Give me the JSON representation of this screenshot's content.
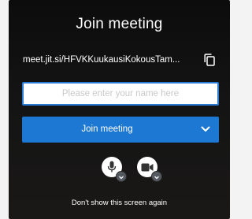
{
  "dialog": {
    "title": "Join meeting",
    "meeting_url": "meet.jit.si/HFVKKuukausiKokousTam...",
    "name_input": {
      "placeholder": "Please enter your name here",
      "value": ""
    },
    "join_button": {
      "label": "Join meeting"
    },
    "footer": {
      "label": "Don't show this screen again"
    }
  },
  "icons": {
    "copy": "copy-icon",
    "chevron": "chevron-down-icon",
    "microphone": "microphone-icon",
    "camera": "camera-icon"
  },
  "colors": {
    "background": "#111111",
    "accent": "#1d78d3",
    "input_border": "#2a7ad8",
    "text": "#ffffff"
  }
}
